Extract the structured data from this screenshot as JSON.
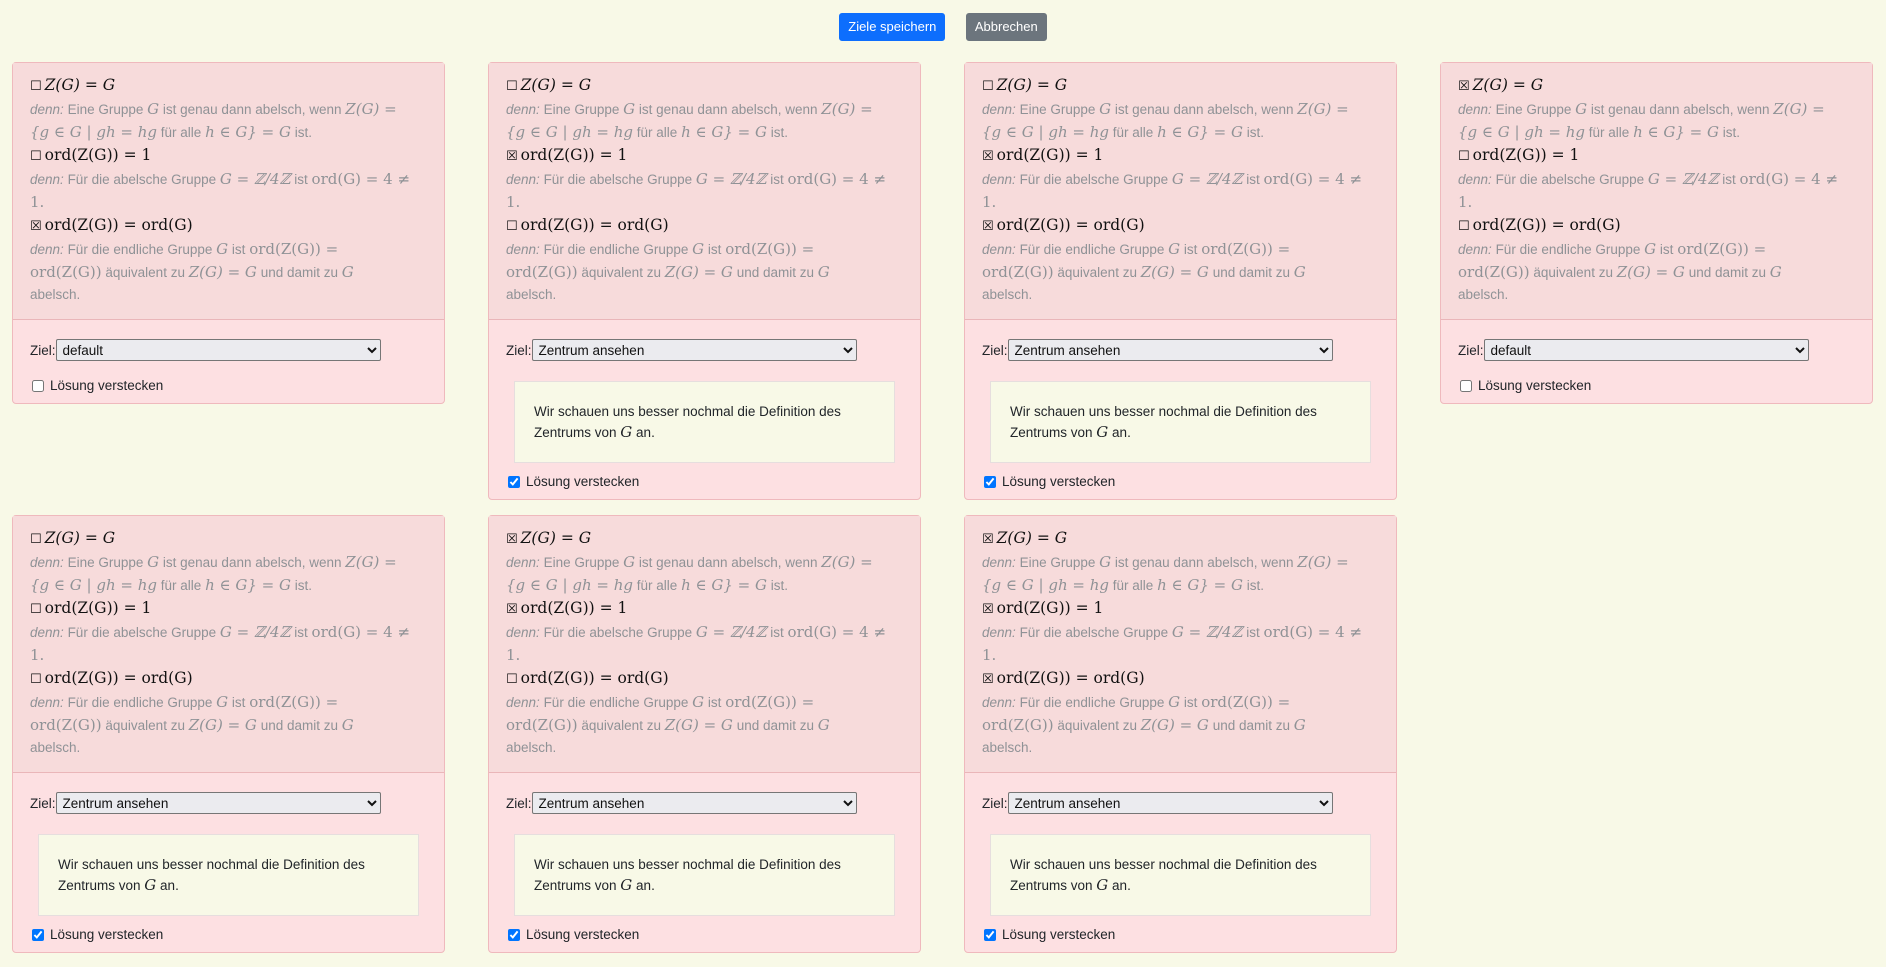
{
  "toolbar": {
    "save_label": "Ziele speichern",
    "cancel_label": "Abbrechen"
  },
  "labels": {
    "ziel": "Ziel:",
    "hide_solution": "Lösung verstecken",
    "denn": "denn:"
  },
  "claims": {
    "c1": "Z(G) = G",
    "c2": "ord(Z(G)) = 1",
    "c3": "ord(Z(G)) = ord(G)"
  },
  "reasons": {
    "r1_a": "Eine Gruppe",
    "r1_b": "ist genau dann abelsch, wenn",
    "r1_c": "Z(G) =",
    "r1_d": "{g ∈ G | gh = hg",
    "r1_e": "für alle",
    "r1_f": "h ∈ G} = G",
    "r1_g": "ist.",
    "r2_a": "Für die abelsche Gruppe",
    "r2_b": "G = ℤ/4ℤ",
    "r2_c": "ist",
    "r2_d": "ord(G) = 4 ≠",
    "r2_e": "1.",
    "r3_a": "Für die endliche Gruppe",
    "r3_b": "ist",
    "r3_c": "ord(Z(G)) =",
    "r3_d": "ord(Z(G))",
    "r3_e": "äquivalent zu",
    "r3_f": "Z(G) = G",
    "r3_g": "und damit zu",
    "r3_h": "abelsch.",
    "var_g": "G"
  },
  "hint": {
    "text_a": "Wir schauen uns besser nochmal die Definition des Zentrums von",
    "var": "G",
    "text_b": "an."
  },
  "select_options": [
    "default",
    "Zentrum ansehen"
  ],
  "cards": [
    {
      "boxes": [
        "☐",
        "☐",
        "☒"
      ],
      "goal": "default",
      "hide": false
    },
    {
      "boxes": [
        "☐",
        "☒",
        "☐"
      ],
      "goal": "Zentrum ansehen",
      "hide": true
    },
    {
      "boxes": [
        "☐",
        "☒",
        "☒"
      ],
      "goal": "Zentrum ansehen",
      "hide": true
    },
    {
      "boxes": [
        "☒",
        "☐",
        "☐"
      ],
      "goal": "default",
      "hide": false
    },
    {
      "boxes": [
        "☐",
        "☐",
        "☐"
      ],
      "goal": "Zentrum ansehen",
      "hide": true
    },
    {
      "boxes": [
        "☒",
        "☒",
        "☐"
      ],
      "goal": "Zentrum ansehen",
      "hide": true
    },
    {
      "boxes": [
        "☒",
        "☒",
        "☒"
      ],
      "goal": "Zentrum ansehen",
      "hide": true
    }
  ],
  "colors": {
    "card_bg": "#fde0e2",
    "card_head_bg": "#f7dbdb",
    "page_bg": "#f8f9e7",
    "primary": "#0d6efd",
    "secondary": "#6c757d"
  }
}
